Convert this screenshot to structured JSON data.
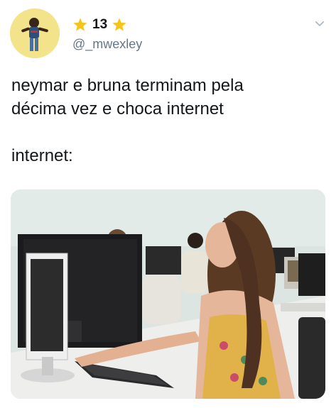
{
  "tweet": {
    "display_name": "13",
    "handle": "@_mwexley",
    "text": "neymar e bruna terminam pela\ndécima vez e choca internet\n\ninternet:"
  },
  "icons": {
    "name_decoration": "star-icon",
    "menu": "chevron-down-icon"
  },
  "colors": {
    "star": "#f5c518",
    "avatar_bg": "#f3e38a",
    "handle": "#657786"
  }
}
